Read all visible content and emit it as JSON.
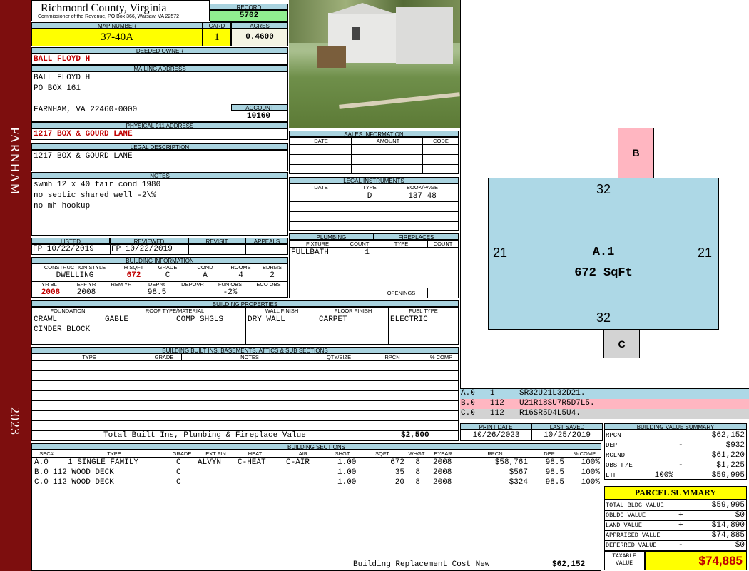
{
  "side": {
    "town": "FARNHAM",
    "year": "2023"
  },
  "header": {
    "county": "Richmond County, Virginia",
    "commissioner": "Commissioner of the Revenue, PO Box 366, Warsaw, VA 22572",
    "record_label": "RECORD",
    "record": "5702",
    "map_label": "MAP NUMBER",
    "map_number": "37-40A",
    "card_label": "CARD",
    "card": "1",
    "acres_label": "ACRES",
    "acres": "0.4600"
  },
  "owner": {
    "deeded_label": "DEEDED OWNER",
    "deeded": "BALL FLOYD H",
    "mailing_label": "MAILING ADDRESS",
    "mailing": [
      "BALL FLOYD H",
      "PO BOX 161",
      "",
      "FARNHAM, VA 22460-0000"
    ],
    "account_label": "ACCOUNT",
    "account": "10160",
    "address_label": "PHYSICAL 911 ADDRESS",
    "address": "1217 BOX & GOURD LANE",
    "legal_label": "LEGAL DESCRIPTION",
    "legal": "1217 BOX & GOURD LANE",
    "notes_label": "NOTES",
    "notes": [
      "swmh 12 x 40 fair cond 1980",
      "no septic shared well -2\\%",
      "no mh hookup"
    ]
  },
  "listing": {
    "listed_label": "LISTED",
    "reviewed_label": "REVIEWED",
    "revisit_label": "REVISIT",
    "appeals_label": "APPEALS",
    "listed": "FP  10/22/2019",
    "reviewed": "FP  10/22/2019"
  },
  "building_info": {
    "label": "BUILDING INFORMATION",
    "cols": [
      "CONSTRUCTION STYLE",
      "H SQFT",
      "GRADE",
      "COND",
      "ROOMS",
      "BDRMS"
    ],
    "vals": [
      "DWELLING",
      "672",
      "C",
      "A",
      "4",
      "2"
    ],
    "cols2": [
      "YR BLT",
      "EFF YR",
      "REM YR",
      "DEP %",
      "DEPOVR",
      "FUN OBS",
      "ECO OBS"
    ],
    "vals2": [
      "2008",
      "2008",
      "",
      "98.5",
      "",
      "-2%",
      ""
    ]
  },
  "sales": {
    "label": "SALES INFORMATION",
    "cols": [
      "DATE",
      "AMOUNT",
      "CODE"
    ]
  },
  "legal_inst": {
    "label": "LEGAL INSTRUMENTS",
    "cols": [
      "DATE",
      "TYPE",
      "BOOK/PAGE"
    ],
    "type": "D",
    "bookpage": "137 48"
  },
  "plumbing": {
    "label": "PLUMBING",
    "cols": [
      "FIXTURE",
      "COUNT"
    ],
    "fixture": "FULLBATH",
    "count": "1"
  },
  "fireplaces": {
    "label": "FIREPLACES",
    "cols": [
      "TYPE",
      "COUNT"
    ],
    "openings": "OPENINGS"
  },
  "properties": {
    "label": "BUILDING PROPERTIES",
    "cols": [
      "FOUNDATION",
      "ROOF TYPE/MATERIAL",
      "WALL FINISH",
      "FLOOR FINISH",
      "FUEL TYPE"
    ],
    "foundation": [
      "CRAWL",
      "CINDER BLOCK"
    ],
    "roof_type": "GABLE",
    "roof_material": "COMP SHGLS",
    "wall": "DRY WALL",
    "floor": "CARPET",
    "fuel": "ELECTRIC"
  },
  "builtins": {
    "label": "BUILDING BUILT INS, BASEMENTS, ATTICS & SUB SECTIONS",
    "cols": [
      "TYPE",
      "GRADE",
      "NOTES",
      "QTY/SIZE",
      "RPCN",
      "% COMP"
    ],
    "total_label": "Total Built Ins, Plumbing & Fireplace Value",
    "total": "$2,500"
  },
  "sections": {
    "label": "BUILDING SECTIONS",
    "cols": [
      "SEC#",
      "TYPE",
      "GRADE",
      "EXT FIN",
      "HEAT",
      "AIR",
      "SHGT",
      "SQFT",
      "WHGT",
      "EYEAR",
      "RPCN",
      "DEP",
      "% COMP"
    ],
    "rows": [
      [
        "A.0",
        "1 SINGLE FAMILY",
        "C",
        "ALVYN",
        "C-HEAT",
        "C-AIR",
        "1.00",
        "672",
        "8",
        "2008",
        "$58,761",
        "98.5",
        "100%"
      ],
      [
        "B.0",
        "112 WOOD DECK",
        "C",
        "",
        "",
        "",
        "1.00",
        "35",
        "8",
        "2008",
        "$567",
        "98.5",
        "100%"
      ],
      [
        "C.0",
        "112 WOOD DECK",
        "C",
        "",
        "",
        "",
        "1.00",
        "20",
        "8",
        "2008",
        "$324",
        "98.5",
        "100%"
      ]
    ],
    "replacement_label": "Building Replacement Cost New",
    "replacement": "$62,152"
  },
  "sketch": {
    "main_label": "A.1",
    "main_area": "672 SqFt",
    "top": "32",
    "bottom": "32",
    "left": "21",
    "right": "21",
    "b_label": "B",
    "c_label": "C",
    "colors": {
      "main": "#add8e6",
      "b": "#ffb6c1",
      "c": "#d3d3d3"
    },
    "legend": [
      {
        "code": "A.0",
        "num": "1",
        "desc": "SR32U21L32D21."
      },
      {
        "code": "B.0",
        "num": "112",
        "desc": "U21R18SU7R5D7L5."
      },
      {
        "code": "C.0",
        "num": "112",
        "desc": "R16SR5D4L5U4."
      }
    ]
  },
  "dates": {
    "print_label": "PRINT DATE",
    "print": "10/26/2023",
    "saved_label": "LAST SAVED",
    "saved": "10/25/2019"
  },
  "summary": {
    "label": "BUILDING VALUE SUMMARY",
    "rows": [
      {
        "k": "RPCN",
        "s": "",
        "v": "$62,152"
      },
      {
        "k": "DEP",
        "s": "-",
        "v": "$932"
      },
      {
        "k": "RCLND",
        "s": "",
        "v": "$61,220"
      },
      {
        "k": "OBS F/E",
        "s": "-",
        "v": "$1,225"
      },
      {
        "k": "LTF",
        "p": "100%",
        "s": "",
        "v": "$59,995"
      }
    ]
  },
  "parcel": {
    "label": "PARCEL SUMMARY",
    "rows": [
      {
        "k": "TOTAL BLDG VALUE",
        "s": "",
        "v": "$59,995"
      },
      {
        "k": "OBLDG VALUE",
        "s": "+",
        "v": "$0"
      },
      {
        "k": "LAND VALUE",
        "s": "+",
        "v": "$14,890"
      },
      {
        "k": "APPRAISED VALUE",
        "s": "",
        "v": "$74,885"
      },
      {
        "k": "DEFERRED VALUE",
        "s": "-",
        "v": "$0"
      }
    ],
    "taxable_label": "TAXABLE VALUE",
    "taxable": "$74,885"
  }
}
